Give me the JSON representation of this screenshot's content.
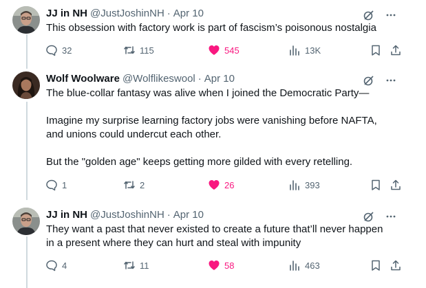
{
  "tweets": [
    {
      "display_name": "JJ in NH",
      "handle": "@JustJoshinNH",
      "separator": "·",
      "date": "Apr 10",
      "text": [
        "This obsession with factory work is part of fascism’s poisonous nostalgia"
      ],
      "stats": {
        "replies": "32",
        "reposts": "115",
        "likes": "545",
        "views": "13K"
      },
      "liked": true
    },
    {
      "display_name": "Wolf Woolware",
      "handle": "@Wolflikeswool",
      "separator": "·",
      "date": "Apr 10",
      "text": [
        "The blue-collar fantasy was alive when I joined the Democratic Party—",
        "",
        "Imagine my surprise learning factory jobs were vanishing before NAFTA,",
        "and unions could undercut each other.",
        "",
        "But the \"golden age\" keeps getting more gilded with every retelling."
      ],
      "stats": {
        "replies": "1",
        "reposts": "2",
        "likes": "26",
        "views": "393"
      },
      "liked": true
    },
    {
      "display_name": "JJ in NH",
      "handle": "@JustJoshinNH",
      "separator": "·",
      "date": "Apr 10",
      "text": [
        "They want a past that never existed to create a future that’ll never happen",
        "in a present where they can hurt and steal with impunity"
      ],
      "stats": {
        "replies": "4",
        "reposts": "11",
        "likes": "58",
        "views": "463"
      },
      "liked": true
    }
  ],
  "colors": {
    "text": "#0f1419",
    "secondary": "#536471",
    "like_active": "#f91880",
    "thread_line": "#cfd9de"
  },
  "icons": [
    "grok-icon",
    "more-icon",
    "reply-icon",
    "repost-icon",
    "like-icon",
    "views-icon",
    "bookmark-icon",
    "share-icon"
  ]
}
